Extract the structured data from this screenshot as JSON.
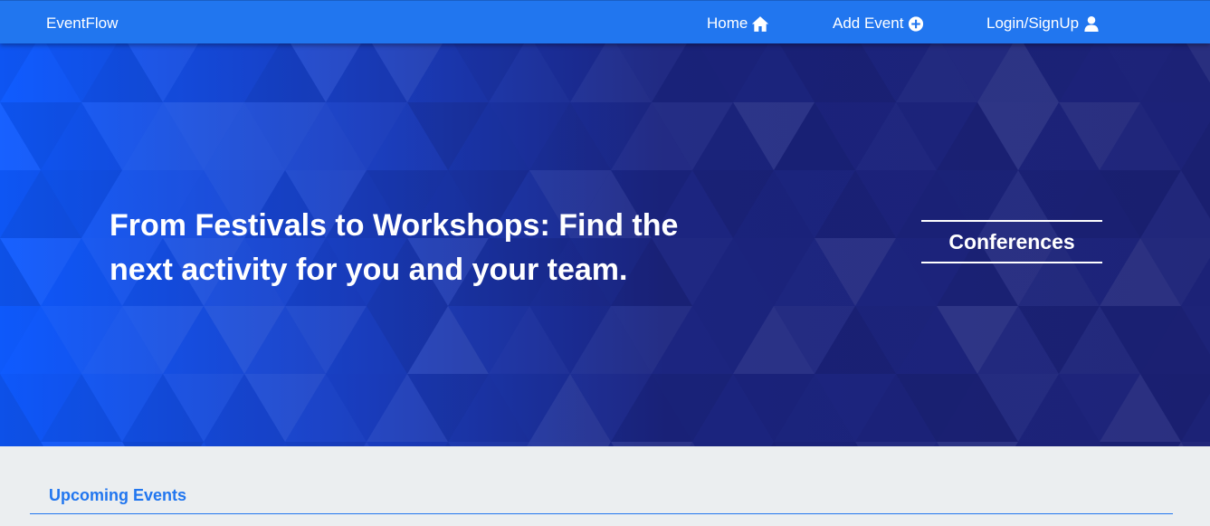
{
  "navbar": {
    "brand": "EventFlow",
    "links": [
      {
        "label": "Home",
        "icon": "home-icon"
      },
      {
        "label": "Add Event",
        "icon": "plus-circle-icon"
      },
      {
        "label": "Login/SignUp",
        "icon": "user-icon"
      }
    ]
  },
  "hero": {
    "title_line1": "From Festivals to Workshops: Find the",
    "title_line2": "next activity for you and your team.",
    "rotating_tag": "Conferences"
  },
  "main": {
    "section_title": "Upcoming Events"
  },
  "colors": {
    "primary": "#2176ef",
    "hero_left": "#0f5bff",
    "hero_right": "#1d2378",
    "page_bg": "#ebeef0"
  }
}
